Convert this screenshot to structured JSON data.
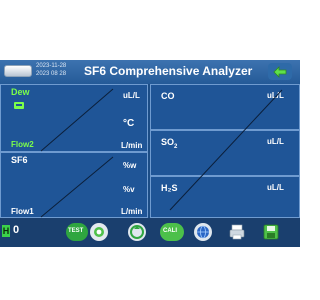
{
  "header": {
    "datetime_line1": "2023-11-28",
    "datetime_line2": "2023 08 28",
    "title": "SF6 Comprehensive Analyzer"
  },
  "dew_panel": {
    "label": "Dew",
    "unit_top": "uL/L",
    "unit_temp": "°C",
    "flow_label": "Flow2",
    "flow_unit": "L/min"
  },
  "sf6_panel": {
    "label": "SF6",
    "unit_1": "%w",
    "unit_2": "%v",
    "flow_label": "Flow1",
    "flow_unit": "L/min"
  },
  "co_panel": {
    "label": "CO",
    "unit": "uL/L"
  },
  "so2_panel": {
    "label": "SO",
    "sub": "2",
    "unit": "uL/L"
  },
  "h2s_panel": {
    "label": "H₂S",
    "unit": "uL/L"
  },
  "status": {
    "h_label": "H",
    "h_value": "0",
    "test_label": "TEST",
    "cali_label": "CALI"
  }
}
